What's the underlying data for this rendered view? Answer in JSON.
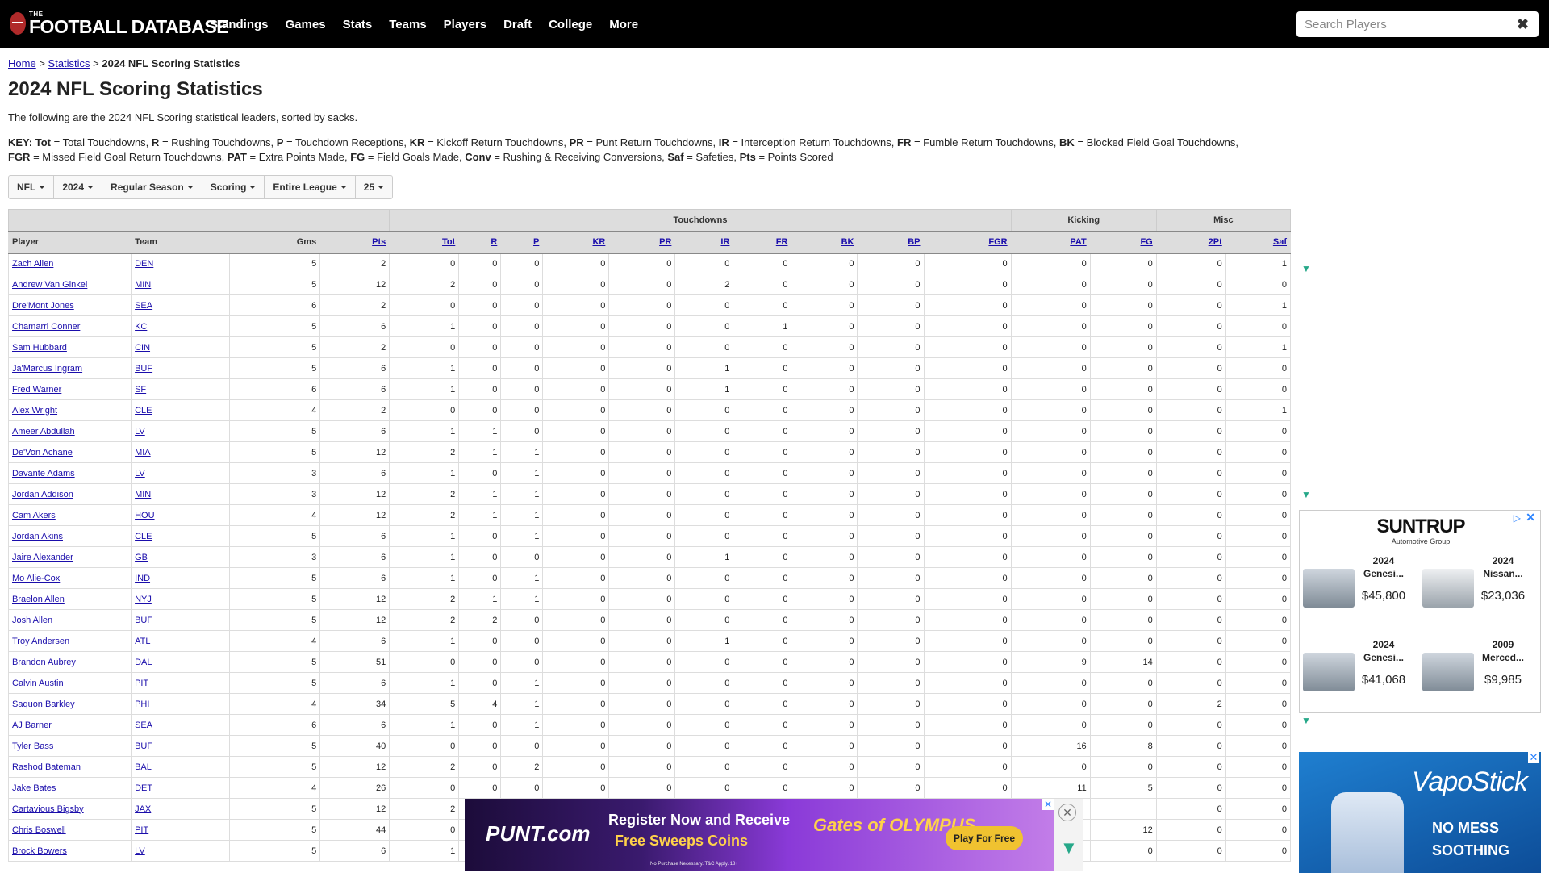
{
  "logo": {
    "small": "THE",
    "main": "FOOTBALL DATABASE"
  },
  "nav": [
    "Standings",
    "Games",
    "Stats",
    "Teams",
    "Players",
    "Draft",
    "College",
    "More"
  ],
  "search": {
    "placeholder": "Search Players"
  },
  "breadcrumb": {
    "home": "Home",
    "sep1": ">",
    "stats": "Statistics",
    "sep2": ">",
    "current": "2024 NFL Scoring Statistics"
  },
  "page_title": "2024 NFL Scoring Statistics",
  "intro": "The following are the 2024 NFL Scoring statistical leaders, sorted by sacks.",
  "key": {
    "label": "KEY:",
    "items": [
      {
        "abbr": "Tot",
        "desc": "= Total Touchdowns,"
      },
      {
        "abbr": "R",
        "desc": "= Rushing Touchdowns,"
      },
      {
        "abbr": "P",
        "desc": "= Touchdown Receptions,"
      },
      {
        "abbr": "KR",
        "desc": "= Kickoff Return Touchdowns,"
      },
      {
        "abbr": "PR",
        "desc": "= Punt Return Touchdowns,"
      },
      {
        "abbr": "IR",
        "desc": "= Interception Return Touchdowns,"
      },
      {
        "abbr": "FR",
        "desc": "= Fumble Return Touchdowns,"
      },
      {
        "abbr": "BK",
        "desc": "= Blocked Field Goal Touchdowns,"
      },
      {
        "abbr": "FGR",
        "desc": "= Missed Field Goal Return Touchdowns,"
      },
      {
        "abbr": "PAT",
        "desc": "= Extra Points Made,"
      },
      {
        "abbr": "FG",
        "desc": "= Field Goals Made,"
      },
      {
        "abbr": "Conv",
        "desc": "= Rushing & Receiving Conversions,"
      },
      {
        "abbr": "Saf",
        "desc": "= Safeties,"
      },
      {
        "abbr": "Pts",
        "desc": "= Points Scored"
      }
    ]
  },
  "filters": [
    "NFL",
    "2024",
    "Regular Season",
    "Scoring",
    "Entire League",
    "25"
  ],
  "table": {
    "groups": {
      "touchdowns": "Touchdowns",
      "kicking": "Kicking",
      "misc": "Misc"
    },
    "headers": [
      "Player",
      "Team",
      "Gms",
      "Pts",
      "Tot",
      "R",
      "P",
      "KR",
      "PR",
      "IR",
      "FR",
      "BK",
      "BP",
      "FGR",
      "PAT",
      "FG",
      "2Pt",
      "Saf"
    ],
    "rows": [
      [
        "Zach Allen",
        "DEN",
        "5",
        "2",
        "0",
        "0",
        "0",
        "0",
        "0",
        "0",
        "0",
        "0",
        "0",
        "0",
        "0",
        "0",
        "0",
        "1"
      ],
      [
        "Andrew Van Ginkel",
        "MIN",
        "5",
        "12",
        "2",
        "0",
        "0",
        "0",
        "0",
        "2",
        "0",
        "0",
        "0",
        "0",
        "0",
        "0",
        "0",
        "0"
      ],
      [
        "Dre'Mont Jones",
        "SEA",
        "6",
        "2",
        "0",
        "0",
        "0",
        "0",
        "0",
        "0",
        "0",
        "0",
        "0",
        "0",
        "0",
        "0",
        "0",
        "1"
      ],
      [
        "Chamarri Conner",
        "KC",
        "5",
        "6",
        "1",
        "0",
        "0",
        "0",
        "0",
        "0",
        "1",
        "0",
        "0",
        "0",
        "0",
        "0",
        "0",
        "0"
      ],
      [
        "Sam Hubbard",
        "CIN",
        "5",
        "2",
        "0",
        "0",
        "0",
        "0",
        "0",
        "0",
        "0",
        "0",
        "0",
        "0",
        "0",
        "0",
        "0",
        "1"
      ],
      [
        "Ja'Marcus Ingram",
        "BUF",
        "5",
        "6",
        "1",
        "0",
        "0",
        "0",
        "0",
        "1",
        "0",
        "0",
        "0",
        "0",
        "0",
        "0",
        "0",
        "0"
      ],
      [
        "Fred Warner",
        "SF",
        "6",
        "6",
        "1",
        "0",
        "0",
        "0",
        "0",
        "1",
        "0",
        "0",
        "0",
        "0",
        "0",
        "0",
        "0",
        "0"
      ],
      [
        "Alex Wright",
        "CLE",
        "4",
        "2",
        "0",
        "0",
        "0",
        "0",
        "0",
        "0",
        "0",
        "0",
        "0",
        "0",
        "0",
        "0",
        "0",
        "1"
      ],
      [
        "Ameer Abdullah",
        "LV",
        "5",
        "6",
        "1",
        "1",
        "0",
        "0",
        "0",
        "0",
        "0",
        "0",
        "0",
        "0",
        "0",
        "0",
        "0",
        "0"
      ],
      [
        "De'Von Achane",
        "MIA",
        "5",
        "12",
        "2",
        "1",
        "1",
        "0",
        "0",
        "0",
        "0",
        "0",
        "0",
        "0",
        "0",
        "0",
        "0",
        "0"
      ],
      [
        "Davante Adams",
        "LV",
        "3",
        "6",
        "1",
        "0",
        "1",
        "0",
        "0",
        "0",
        "0",
        "0",
        "0",
        "0",
        "0",
        "0",
        "0",
        "0"
      ],
      [
        "Jordan Addison",
        "MIN",
        "3",
        "12",
        "2",
        "1",
        "1",
        "0",
        "0",
        "0",
        "0",
        "0",
        "0",
        "0",
        "0",
        "0",
        "0",
        "0"
      ],
      [
        "Cam Akers",
        "HOU",
        "4",
        "12",
        "2",
        "1",
        "1",
        "0",
        "0",
        "0",
        "0",
        "0",
        "0",
        "0",
        "0",
        "0",
        "0",
        "0"
      ],
      [
        "Jordan Akins",
        "CLE",
        "5",
        "6",
        "1",
        "0",
        "1",
        "0",
        "0",
        "0",
        "0",
        "0",
        "0",
        "0",
        "0",
        "0",
        "0",
        "0"
      ],
      [
        "Jaire Alexander",
        "GB",
        "3",
        "6",
        "1",
        "0",
        "0",
        "0",
        "0",
        "1",
        "0",
        "0",
        "0",
        "0",
        "0",
        "0",
        "0",
        "0"
      ],
      [
        "Mo Alie-Cox",
        "IND",
        "5",
        "6",
        "1",
        "0",
        "1",
        "0",
        "0",
        "0",
        "0",
        "0",
        "0",
        "0",
        "0",
        "0",
        "0",
        "0"
      ],
      [
        "Braelon Allen",
        "NYJ",
        "5",
        "12",
        "2",
        "1",
        "1",
        "0",
        "0",
        "0",
        "0",
        "0",
        "0",
        "0",
        "0",
        "0",
        "0",
        "0"
      ],
      [
        "Josh Allen",
        "BUF",
        "5",
        "12",
        "2",
        "2",
        "0",
        "0",
        "0",
        "0",
        "0",
        "0",
        "0",
        "0",
        "0",
        "0",
        "0",
        "0"
      ],
      [
        "Troy Andersen",
        "ATL",
        "4",
        "6",
        "1",
        "0",
        "0",
        "0",
        "0",
        "1",
        "0",
        "0",
        "0",
        "0",
        "0",
        "0",
        "0",
        "0"
      ],
      [
        "Brandon Aubrey",
        "DAL",
        "5",
        "51",
        "0",
        "0",
        "0",
        "0",
        "0",
        "0",
        "0",
        "0",
        "0",
        "0",
        "9",
        "14",
        "0",
        "0"
      ],
      [
        "Calvin Austin",
        "PIT",
        "5",
        "6",
        "1",
        "0",
        "1",
        "0",
        "0",
        "0",
        "0",
        "0",
        "0",
        "0",
        "0",
        "0",
        "0",
        "0"
      ],
      [
        "Saquon Barkley",
        "PHI",
        "4",
        "34",
        "5",
        "4",
        "1",
        "0",
        "0",
        "0",
        "0",
        "0",
        "0",
        "0",
        "0",
        "0",
        "2",
        "0"
      ],
      [
        "AJ Barner",
        "SEA",
        "6",
        "6",
        "1",
        "0",
        "1",
        "0",
        "0",
        "0",
        "0",
        "0",
        "0",
        "0",
        "0",
        "0",
        "0",
        "0"
      ],
      [
        "Tyler Bass",
        "BUF",
        "5",
        "40",
        "0",
        "0",
        "0",
        "0",
        "0",
        "0",
        "0",
        "0",
        "0",
        "0",
        "16",
        "8",
        "0",
        "0"
      ],
      [
        "Rashod Bateman",
        "BAL",
        "5",
        "12",
        "2",
        "0",
        "2",
        "0",
        "0",
        "0",
        "0",
        "0",
        "0",
        "0",
        "0",
        "0",
        "0",
        "0"
      ],
      [
        "Jake Bates",
        "DET",
        "4",
        "26",
        "0",
        "0",
        "0",
        "0",
        "0",
        "0",
        "0",
        "0",
        "0",
        "0",
        "11",
        "5",
        "0",
        "0"
      ],
      [
        "Cartavious Bigsby",
        "JAX",
        "5",
        "12",
        "2",
        "",
        "",
        "",
        "",
        "",
        "",
        "",
        "",
        "",
        "",
        "",
        "0",
        "0"
      ],
      [
        "Chris Boswell",
        "PIT",
        "5",
        "44",
        "0",
        "",
        "",
        "",
        "",
        "",
        "",
        "",
        "",
        "",
        "",
        "12",
        "0",
        "0"
      ],
      [
        "Brock Bowers",
        "LV",
        "5",
        "6",
        "1",
        "",
        "",
        "",
        "",
        "",
        "",
        "",
        "",
        "",
        "",
        "0",
        "0",
        "0"
      ]
    ]
  },
  "ad_suntrup": {
    "brand": "SUNTRUP",
    "sub": "Automotive Group",
    "cars": [
      {
        "year": "2024",
        "name": "Genesi...",
        "price": "$45,800"
      },
      {
        "year": "2024",
        "name": "Nissan...",
        "price": "$23,036"
      },
      {
        "year": "2024",
        "name": "Genesi...",
        "price": "$41,068"
      },
      {
        "year": "2009",
        "name": "Merced...",
        "price": "$9,985"
      }
    ]
  },
  "ad_vapostick": {
    "brand": "VapoStick",
    "line1": "NO MESS",
    "line2": "SOOTHING"
  },
  "ad_punt": {
    "brand": "PUNT.com",
    "line1": "Register Now and Receive",
    "line2": "Free Sweeps Coins",
    "game": "Gates of OLYMPUS",
    "cta": "Play For Free",
    "disclaimer": "No Purchase Necessary. T&C Apply. 18+"
  }
}
